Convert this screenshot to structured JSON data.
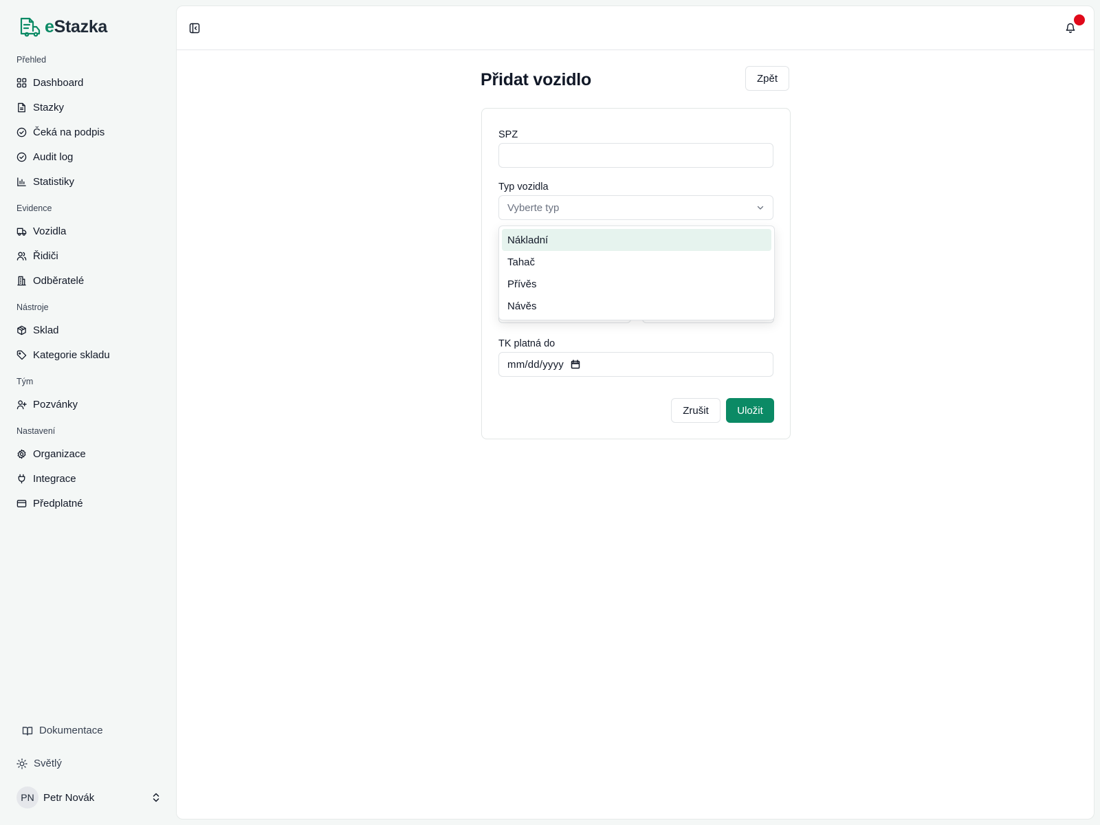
{
  "brand": {
    "name_prefix": "e",
    "name_rest": "Stazka"
  },
  "colors": {
    "accent": "#0b8a65",
    "notification": "#e0091a",
    "option_highlight": "#e6f3ee"
  },
  "sidebar": {
    "sections": [
      {
        "label": "Přehled",
        "items": [
          {
            "label": "Dashboard",
            "icon": "grid-icon"
          },
          {
            "label": "Stazky",
            "icon": "document-icon"
          },
          {
            "label": "Čeká na podpis",
            "icon": "check-circle-icon"
          },
          {
            "label": "Audit log",
            "icon": "check-circle-icon"
          },
          {
            "label": "Statistiky",
            "icon": "bar-chart-icon"
          }
        ]
      },
      {
        "label": "Evidence",
        "items": [
          {
            "label": "Vozidla",
            "icon": "truck-icon"
          },
          {
            "label": "Řidiči",
            "icon": "users-icon"
          },
          {
            "label": "Odběratelé",
            "icon": "building-icon"
          }
        ]
      },
      {
        "label": "Nástroje",
        "items": [
          {
            "label": "Sklad",
            "icon": "package-icon"
          },
          {
            "label": "Kategorie skladu",
            "icon": "tag-icon"
          }
        ]
      },
      {
        "label": "Tým",
        "items": [
          {
            "label": "Pozvánky",
            "icon": "user-plus-icon"
          }
        ]
      },
      {
        "label": "Nastavení",
        "items": [
          {
            "label": "Organizace",
            "icon": "gear-icon"
          },
          {
            "label": "Integrace",
            "icon": "plug-icon"
          },
          {
            "label": "Předplatné",
            "icon": "credit-card-icon"
          }
        ]
      }
    ],
    "footer": {
      "docs_label": "Dokumentace",
      "theme_label": "Světlý",
      "user_initials": "PN",
      "user_name": "Petr Novák"
    }
  },
  "page": {
    "title": "Přidat vozidlo",
    "back_label": "Zpět"
  },
  "form": {
    "spz_label": "SPZ",
    "spz_value": "",
    "type_label": "Typ vozidla",
    "type_placeholder": "Vyberte typ",
    "type_options": [
      "Nákladní",
      "Tahač",
      "Přívěs",
      "Návěs"
    ],
    "type_highlighted_option": "Nákladní",
    "tk_label": "TK platná do",
    "tk_placeholder": "mm/dd/yyyy",
    "cancel_label": "Zrušit",
    "save_label": "Uložit"
  }
}
